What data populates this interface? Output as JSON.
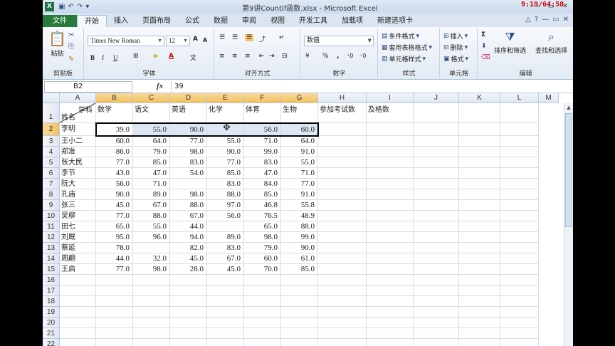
{
  "window": {
    "title": "第9讲Countif函数.xlsx - Microsoft Excel",
    "clock": "9:19/64:58",
    "logo": "X"
  },
  "tabs": [
    {
      "label": "文件"
    },
    {
      "label": "开始"
    },
    {
      "label": "插入"
    },
    {
      "label": "页面布局"
    },
    {
      "label": "公式"
    },
    {
      "label": "数据"
    },
    {
      "label": "审阅"
    },
    {
      "label": "视图"
    },
    {
      "label": "开发工具"
    },
    {
      "label": "加载项"
    },
    {
      "label": "新建选项卡"
    }
  ],
  "ribbon": {
    "clipboard": {
      "label": "剪贴板",
      "paste": "粘贴"
    },
    "font": {
      "label": "字体",
      "name": "Times New Roman",
      "size": "12",
      "bold": "B",
      "italic": "I",
      "underline": "U",
      "grow": "A",
      "shrink": "A",
      "color_a": "A"
    },
    "alignment": {
      "label": "对齐方式"
    },
    "number": {
      "label": "数字",
      "format": "数值",
      "percent": "%",
      "comma": ","
    },
    "styles": {
      "label": "样式",
      "conditional": "条件格式",
      "table": "套用表格格式",
      "cell": "单元格样式"
    },
    "cells": {
      "label": "单元格",
      "insert": "插入",
      "delete": "删除",
      "format": "格式"
    },
    "editing": {
      "label": "编辑",
      "sort": "排序和筛选",
      "find": "查找和选择",
      "sum": "Σ"
    }
  },
  "formula_bar": {
    "name_box": "B2",
    "fx": "fx",
    "value": "39"
  },
  "sheet": {
    "columns": [
      "A",
      "B",
      "C",
      "D",
      "E",
      "F",
      "G",
      "H",
      "I",
      "J",
      "K",
      "L",
      "M"
    ],
    "header_row": {
      "a_top": "学科",
      "a_bottom": "姓名",
      "subjects": [
        "数学",
        "语文",
        "英语",
        "化学",
        "体育",
        "生物"
      ],
      "h": "参加考试数",
      "i": "及格数"
    },
    "rows": [
      {
        "name": "李明",
        "values": [
          "39.0",
          "55.0",
          "90.0",
          "",
          "56.0",
          "60.0"
        ]
      },
      {
        "name": "王小二",
        "values": [
          "60.0",
          "64.0",
          "77.0",
          "55.0",
          "71.0",
          "64.0"
        ]
      },
      {
        "name": "郑准",
        "values": [
          "86.0",
          "79.0",
          "98.0",
          "90.0",
          "99.0",
          "91.0"
        ]
      },
      {
        "name": "张大民",
        "values": [
          "77.0",
          "85.0",
          "83.0",
          "77.0",
          "83.0",
          "55.0"
        ]
      },
      {
        "name": "李节",
        "values": [
          "43.0",
          "47.0",
          "54.0",
          "85.0",
          "47.0",
          "71.0"
        ]
      },
      {
        "name": "阮大",
        "values": [
          "56.0",
          "71.0",
          "",
          "83.0",
          "84.0",
          "77.0"
        ]
      },
      {
        "name": "孔庙",
        "values": [
          "90.0",
          "89.0",
          "98.0",
          "88.0",
          "85.0",
          "91.0"
        ]
      },
      {
        "name": "张三",
        "values": [
          "45.0",
          "67.0",
          "88.0",
          "97.0",
          "46.8",
          "55.8"
        ]
      },
      {
        "name": "吴柳",
        "values": [
          "77.0",
          "88.0",
          "67.0",
          "56.0",
          "76.5",
          "48.9"
        ]
      },
      {
        "name": "田七",
        "values": [
          "65.0",
          "55.0",
          "44.0",
          "",
          "65.0",
          "88.0"
        ]
      },
      {
        "name": "刘厩",
        "values": [
          "95.0",
          "96.0",
          "94.0",
          "89.0",
          "98.0",
          "99.0"
        ]
      },
      {
        "name": "蔡延",
        "values": [
          "78.0",
          "",
          "82.0",
          "83.0",
          "79.0",
          "90.0"
        ]
      },
      {
        "name": "周翩",
        "values": [
          "44.0",
          "32.0",
          "45.0",
          "67.0",
          "60.0",
          "61.0"
        ]
      },
      {
        "name": "王启",
        "values": [
          "77.0",
          "98.0",
          "28.0",
          "45.0",
          "70.0",
          "85.0"
        ]
      }
    ],
    "row_numbers": [
      "1",
      "2",
      "3",
      "4",
      "5",
      "6",
      "7",
      "8",
      "9",
      "10",
      "11",
      "12",
      "13",
      "14",
      "15",
      "16",
      "17",
      "18",
      "19",
      "20",
      "21",
      "22"
    ]
  }
}
